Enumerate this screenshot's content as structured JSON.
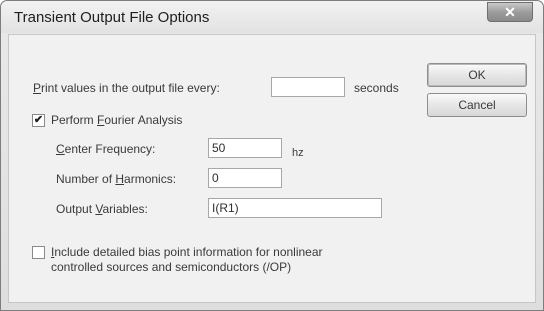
{
  "window": {
    "title": "Transient Output File Options",
    "close_glyph": "✕"
  },
  "print_every": {
    "label_prefix": "P",
    "label_rest": "rint values in the output file every:",
    "value": "",
    "unit": "seconds"
  },
  "fourier": {
    "checked": true,
    "check_glyph": "✔",
    "label_pre": "Perform ",
    "label_u": "F",
    "label_post": "ourier Analysis",
    "center_frequency": {
      "label_u": "C",
      "label_rest": "enter Frequency:",
      "value": "50",
      "unit": "hz"
    },
    "harmonics": {
      "label_pre": "Number of ",
      "label_u": "H",
      "label_post": "armonics:",
      "value": "0"
    },
    "output_variables": {
      "label_pre": "Output ",
      "label_u": "V",
      "label_post": "ariables:",
      "value": "I(R1)"
    }
  },
  "bias": {
    "checked": false,
    "label_u": "I",
    "line1_rest": "nclude detailed bias point information for nonlinear",
    "line2": "controlled sources and semiconductors (/OP)"
  },
  "buttons": {
    "ok": "OK",
    "cancel": "Cancel"
  },
  "icons": {
    "close": "close-icon",
    "check": "checkmark-icon"
  }
}
